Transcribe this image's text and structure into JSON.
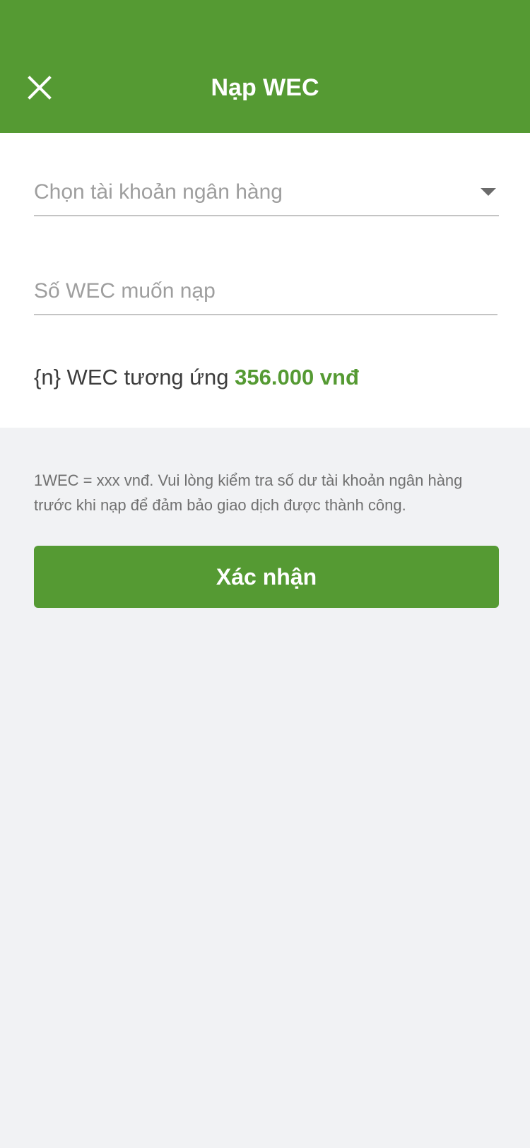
{
  "header": {
    "title": "Nạp WEC",
    "close_icon": "close-icon"
  },
  "form": {
    "bank_select": {
      "placeholder": "Chọn tài khoản ngân hàng",
      "value": "",
      "icon": "caret-down-icon"
    },
    "amount_input": {
      "placeholder": "Số WEC muốn nạp",
      "value": ""
    },
    "equivalent": {
      "prefix": "{n} WEC tương ứng ",
      "amount": "356.000 vnđ"
    }
  },
  "note": "1WEC = xxx vnđ. Vui lòng kiểm tra số dư tài khoản ngân hàng trước khi nạp để đảm bảo giao dịch được thành công.",
  "confirm_button": {
    "label": "Xác nhận"
  },
  "colors": {
    "brand_green": "#559a33",
    "background": "#f1f2f4",
    "placeholder_gray": "#9e9e9e"
  }
}
